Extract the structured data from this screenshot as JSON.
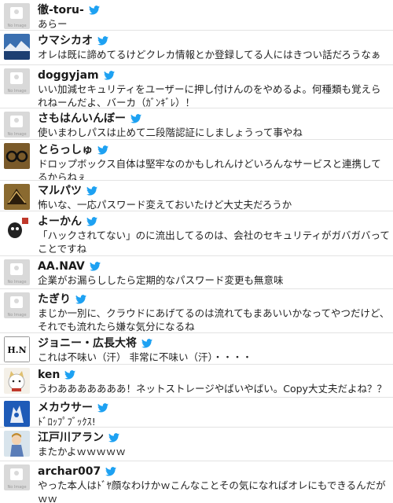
{
  "tweets": [
    {
      "name": "徹-toru-",
      "text": "あらー",
      "avatar": "no-image"
    },
    {
      "name": "ウマシカオ",
      "text": "オレは既に諦めてるけどクレカ情報とか登録してる人にはきつい話だろうなぁ",
      "avatar": "landscape"
    },
    {
      "name": "doggyjam",
      "text": "いい加減セキュリティをユーザーに押し付けんのをやめるよ。何種類も覚えられねーんだよ、バーカ（ｶﾞﾝｷﾞﾚ）！",
      "avatar": "no-image"
    },
    {
      "name": "さもはんいんぼー",
      "text": "使いまわしパスは止めて二段階認証にしましょうって事やね",
      "avatar": "no-image"
    },
    {
      "name": "とらっしゅ",
      "text": "ドロップボックス自体は堅牢なのかもしれんけどいろんなサービスと連携してるからねぇ",
      "avatar": "glasses"
    },
    {
      "name": "マルパツ",
      "text": "怖いな、一応パスワード変えておいたけど大丈夫だろうか",
      "avatar": "bird"
    },
    {
      "name": "よーかん",
      "text": "「ハックされてない」のに流出してるのは、会社のセキュリティがガバガバってことですね",
      "avatar": "character"
    },
    {
      "name": "AA.NAV",
      "text": "企業がお漏らししたら定期的なパスワード変更も無意味",
      "avatar": "no-image"
    },
    {
      "name": "たぎり",
      "text": "まじか一別に、クラウドにあげてるのは流れてもまあいいかなってやつだけど、それでも流れたら嫌な気分になるね",
      "avatar": "no-image"
    },
    {
      "name": "ジョニー・広長大将",
      "text": "これは不味い（汗） 非常に不味い（汗）・・・・",
      "avatar": "hn-logo"
    },
    {
      "name": "ken",
      "text": "うわあああああああ！ネットストレージやばいやばい。Copy大丈夫だよね？？",
      "avatar": "cat"
    },
    {
      "name": "メカウサー",
      "text": "ﾄﾞﾛｯﾌﾟﾌﾞｯｸｽ!",
      "avatar": "mecha"
    },
    {
      "name": "江戸川アラン",
      "text": "またかよｗｗｗｗｗ",
      "avatar": "anime"
    },
    {
      "name": "archar007",
      "text": "やった本人はﾄﾞﾔ顔なわけかｗこんなことその気になればオレにもできるんだがｗｗ",
      "avatar": "no-image"
    }
  ],
  "no_image_label": "No Image",
  "hn_logo_text": "H.N",
  "twitter_blue": "#1da1f2",
  "bird_icon": "twitter-bird-icon"
}
